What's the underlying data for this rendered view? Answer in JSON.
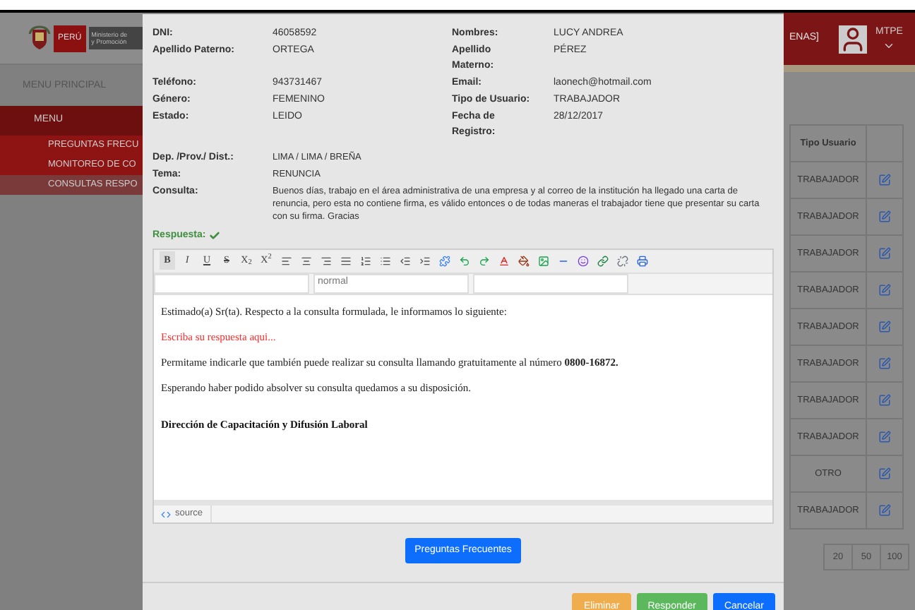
{
  "sidebar": {
    "logo_text": "PERÚ",
    "ministry_lines": [
      "Ministerio de",
      "y Promoción"
    ],
    "section_title": "MENU PRINCIPAL",
    "menu_title": "MENU",
    "items": [
      {
        "label": "PREGUNTAS FRECU",
        "selected": false
      },
      {
        "label": "MONITOREO DE CO",
        "selected": false
      },
      {
        "label": "CONSULTAS RESPO",
        "selected": true
      }
    ]
  },
  "header": {
    "user_text": "ENAS]",
    "user_name": "MTPE"
  },
  "table": {
    "columns": [
      "Tipo Usuario"
    ],
    "rows": [
      {
        "tipo_usuario": "TRABAJADOR"
      },
      {
        "tipo_usuario": "TRABAJADOR"
      },
      {
        "tipo_usuario": "TRABAJADOR"
      },
      {
        "tipo_usuario": "TRABAJADOR"
      },
      {
        "tipo_usuario": "TRABAJADOR"
      },
      {
        "tipo_usuario": "TRABAJADOR"
      },
      {
        "tipo_usuario": "TRABAJADOR"
      },
      {
        "tipo_usuario": "TRABAJADOR"
      },
      {
        "tipo_usuario": "OTRO"
      },
      {
        "tipo_usuario": "TRABAJADOR"
      }
    ]
  },
  "pagination": [
    "20",
    "50",
    "100"
  ],
  "modal": {
    "info_rows": [
      [
        {
          "label": "DNI:",
          "value": "46058592"
        },
        {
          "label": "Nombres:",
          "value": "LUCY ANDREA"
        }
      ],
      [
        {
          "label": "Apellido Paterno:",
          "value": "ORTEGA"
        },
        {
          "label": "Apellido Materno:",
          "value": "PÉREZ"
        }
      ],
      [
        {
          "label": "Teléfono:",
          "value": "943731467"
        },
        {
          "label": "Email:",
          "value": "laonech@hotmail.com"
        }
      ],
      [
        {
          "label": "Género:",
          "value": "FEMENINO"
        },
        {
          "label": "Tipo de Usuario:",
          "value": "TRABAJADOR"
        }
      ],
      [
        {
          "label": "Estado:",
          "value": "LEIDO"
        },
        {
          "label": "Fecha de Registro:",
          "value": "28/12/2017"
        }
      ]
    ],
    "details": [
      {
        "label": "Dep. /Prov./ Dist.:",
        "value": "LIMA / LIMA / BREÑA"
      },
      {
        "label": "Tema:",
        "value": "RENUNCIA"
      },
      {
        "label": "Consulta:",
        "value": "Buenos días, trabajo en el área administrativa de una empresa y al correo de la institución ha llegado una carta de renuncia, pero esta no contiene firma, es válido entonces o de todas maneras el trabajador tiene que presentar su carta con su firma. Gracias"
      }
    ],
    "response_label": "Respuesta:",
    "toolbar": [
      {
        "kind": "bold",
        "label": "B"
      },
      {
        "kind": "italic",
        "label": "I"
      },
      {
        "kind": "underline",
        "label": "U"
      },
      {
        "kind": "strike",
        "label": "S"
      },
      {
        "kind": "sub",
        "label": "X$_{2}$"
      },
      {
        "kind": "sup",
        "label": "X$^{2}$"
      }
    ],
    "style_select": "normal",
    "paragraphs": [
      {
        "kind": "normal",
        "text": "Estimado(a) Sr(ta). Respecto a la consulta formulada, le informamos lo siguiente:"
      },
      {
        "kind": "placeholder",
        "text": "Escriba su respuesta aqui..."
      },
      {
        "kind": "normal",
        "text": "Permitame indicarle que también puede realizar su consulta llamando gratuitamente al número **0800-16872.**"
      },
      {
        "kind": "normal",
        "text": "Esperando haber podido absolver su consulta quedamos a su disposición."
      },
      {
        "kind": "signature",
        "text": "Dirección de Capacitación y Difusión Laboral"
      }
    ],
    "source_label": "source",
    "faq_button": "Preguntas Frecuentes",
    "buttons": [
      {
        "kind": "warning",
        "label": "Eliminar"
      },
      {
        "kind": "success",
        "label": "Responder"
      },
      {
        "kind": "primary",
        "label": "Cancelar"
      }
    ]
  }
}
